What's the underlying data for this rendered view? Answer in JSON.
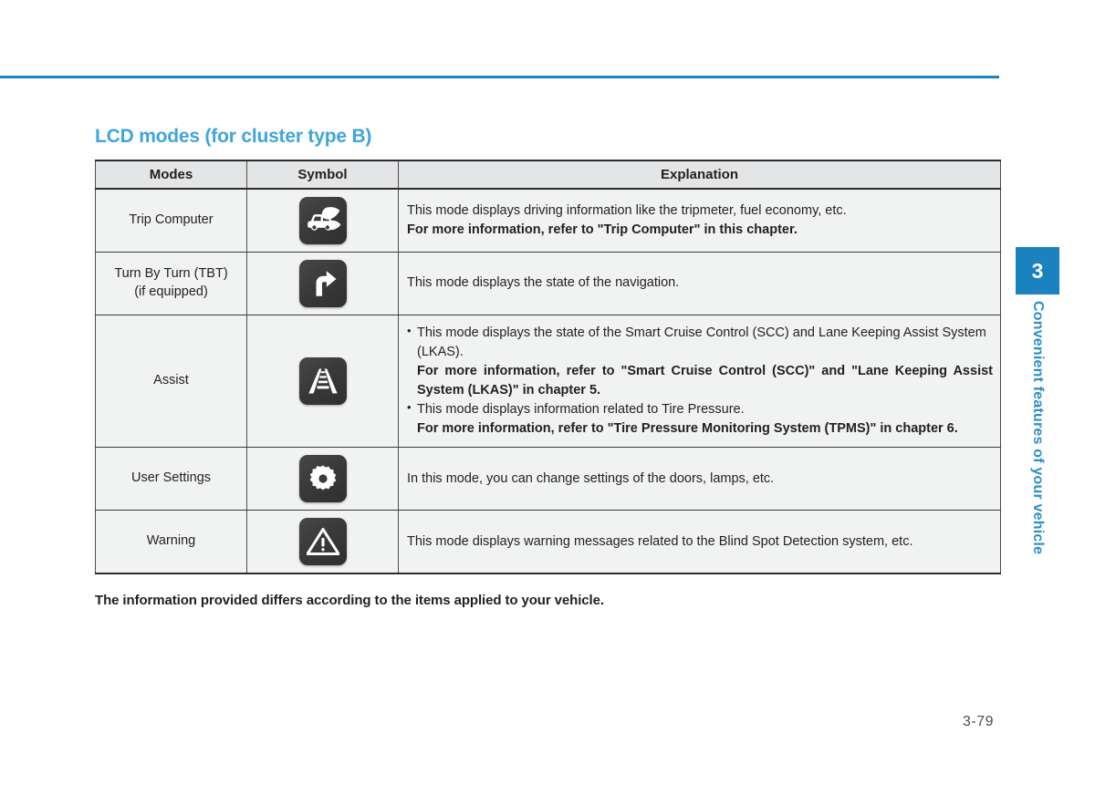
{
  "page": {
    "heading": "LCD modes (for cluster type B)",
    "note": "The information provided differs according to the items applied to your vehicle.",
    "page_number": "3-79",
    "accent_color": "#40a5dc",
    "rule_color": "#1b82c0"
  },
  "chapter_tab": {
    "number": "3",
    "title": "Convenient features of your vehicle",
    "color": "#1b82c0"
  },
  "table": {
    "headers": {
      "modes": "Modes",
      "symbol": "Symbol",
      "explanation": "Explanation"
    },
    "rows": [
      {
        "mode": "Trip Computer",
        "mode_sub": "",
        "icon": "eco-car-leaf-icon",
        "explanation": {
          "line1": "This mode displays driving information like the tripmeter, fuel economy, etc.",
          "line2": "For more information, refer to \"Trip Computer\" in this chapter."
        }
      },
      {
        "mode": "Turn By Turn (TBT)",
        "mode_sub": "(if equipped)",
        "icon": "turn-right-arrow-icon",
        "explanation": {
          "line1": "This mode displays the state of the navigation."
        }
      },
      {
        "mode": "Assist",
        "mode_sub": "",
        "icon": "lane-road-icon",
        "explanation": {
          "bullet1": "This mode displays the state of the Smart Cruise Control (SCC) and Lane Keeping Assist System (LKAS).",
          "bullet1_bold": "For more information, refer to \"Smart Cruise Control (SCC)\" and \"Lane Keeping Assist System (LKAS)\" in chapter 5.",
          "bullet2": "This mode displays information related to Tire Pressure.",
          "bullet2_bold": "For more information, refer to \"Tire Pressure Monitoring System (TPMS)\" in chapter 6."
        }
      },
      {
        "mode": "User Settings",
        "mode_sub": "",
        "icon": "gear-icon",
        "explanation": {
          "line1": "In this mode, you can change settings of the doors, lamps, etc."
        }
      },
      {
        "mode": "Warning",
        "mode_sub": "",
        "icon": "warning-triangle-icon",
        "explanation": {
          "line1": "This mode displays warning messages related to the Blind Spot Detection system, etc."
        }
      }
    ]
  }
}
